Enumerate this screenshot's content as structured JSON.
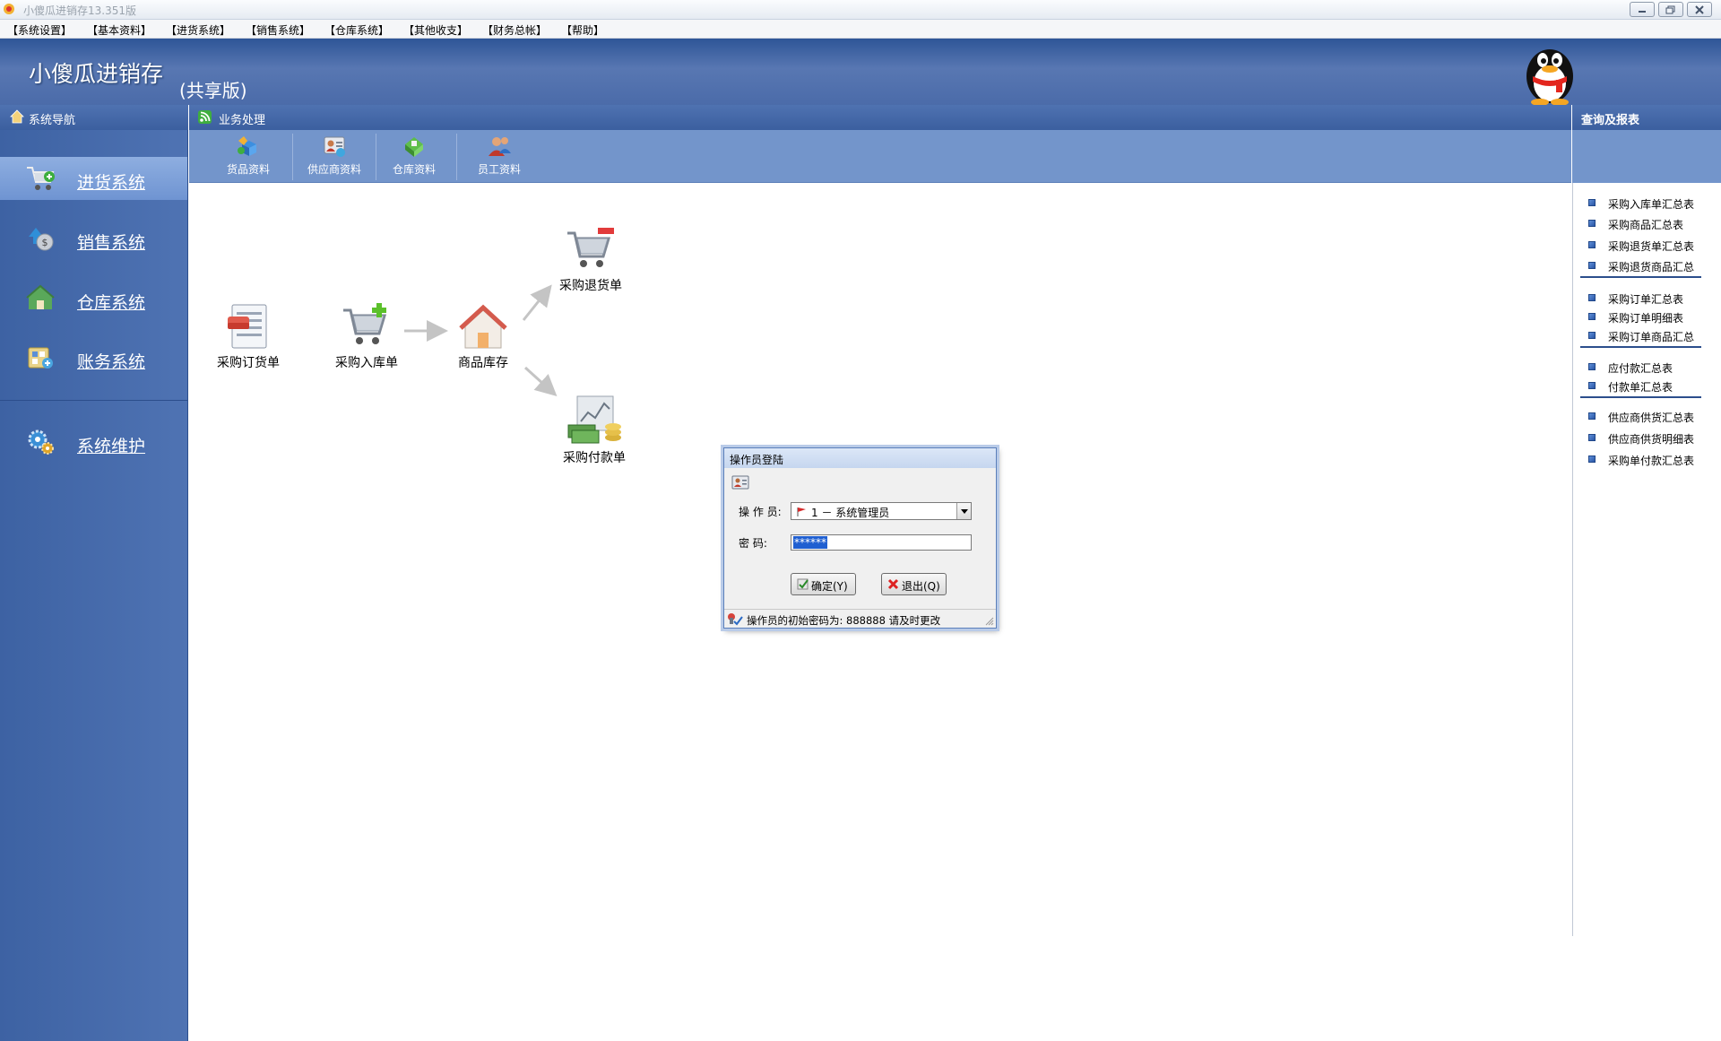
{
  "window": {
    "title": "小傻瓜进销存13.351版",
    "buttons": [
      "minimize-icon",
      "maximize-icon",
      "close-icon"
    ]
  },
  "menu": [
    "【系统设置】",
    "【基本资料】",
    "【进货系统】",
    "【销售系统】",
    "【仓库系统】",
    "【其他收支】",
    "【财务总帐】",
    "【帮助】"
  ],
  "header": {
    "app_name": "小傻瓜进销存",
    "edition": "(共享版)"
  },
  "left_nav": {
    "title": "系统导航",
    "items": [
      {
        "label": "进货系统",
        "icon": "cart-icon",
        "active": true
      },
      {
        "label": "销售系统",
        "icon": "money-icon",
        "active": false
      },
      {
        "label": "仓库系统",
        "icon": "warehouse-icon",
        "active": false
      },
      {
        "label": "账务系统",
        "icon": "ledger-icon",
        "active": false
      },
      {
        "label": "系统维护",
        "icon": "gear-icon",
        "active": false
      }
    ]
  },
  "center": {
    "title": "业务处理",
    "toolbar": [
      {
        "label": "货品资料",
        "icon": "goods-icon"
      },
      {
        "label": "供应商资料",
        "icon": "supplier-icon"
      },
      {
        "label": "仓库资料",
        "icon": "warehouse-data-icon"
      },
      {
        "label": "员工资料",
        "icon": "staff-icon"
      }
    ]
  },
  "flow": {
    "order": "采购订货单",
    "inbound": "采购入库单",
    "stock": "商品库存",
    "return": "采购退货单",
    "payment": "采购付款单"
  },
  "reports": {
    "title": "查询及报表",
    "groups": [
      [
        "采购入库单汇总表",
        "采购商品汇总表",
        "采购退货单汇总表",
        "采购退货商品汇总"
      ],
      [
        "采购订单汇总表",
        "采购订单明细表",
        "采购订单商品汇总"
      ],
      [
        "应付款汇总表",
        "付款单汇总表"
      ],
      [
        "供应商供货汇总表",
        "供应商供货明细表",
        "采购单付款汇总表"
      ]
    ]
  },
  "dialog": {
    "title": "操作员登陆",
    "operator_label": "操 作 员:",
    "operator_value": "1 － 系统管理员",
    "password_label": "密    码:",
    "password_value": "******",
    "ok_label": "确定(Y)",
    "exit_label": "退出(Q)",
    "status": "操作员的初始密码为: 888888 请及时更改"
  },
  "colors": {
    "nav_bg": "#4a6eae",
    "header_bg": "#3b5f9f",
    "toolbar_bg": "#7395cb",
    "active_item": "#7e9fd8"
  }
}
